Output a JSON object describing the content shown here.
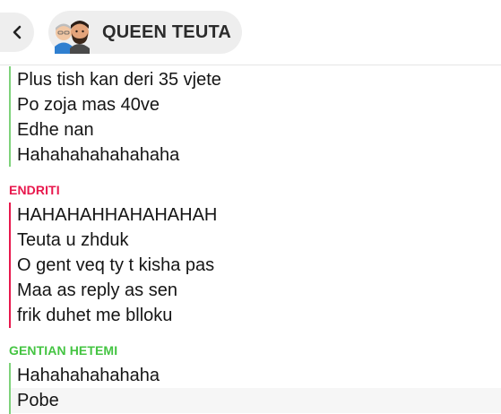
{
  "header": {
    "title": "QUEEN TEUTA",
    "back_icon": "chevron-left-icon",
    "avatar_icon": "group-bitmoji-avatar-icon"
  },
  "colors": {
    "green_sender": "#44c442",
    "red_sender": "#e8184d",
    "bar_green": "#7ed27b",
    "bar_red": "#e8184d"
  },
  "messages": {
    "group1": {
      "lines": [
        "Plus tish kan deri 35 vjete",
        "Po zoja mas 40ve",
        "Edhe nan",
        "Hahahahahahahaha"
      ]
    },
    "group2": {
      "sender": "ENDRITI",
      "lines": [
        "HAHAHAHHAHAHAHAH",
        "Teuta u zhduk",
        "O gent veq ty t kisha pas",
        "Maa as reply as sen",
        "frik duhet me blloku"
      ]
    },
    "group3": {
      "sender": "GENTIAN HETEMI",
      "lines": [
        "Hahahahahahaha",
        "Pobe"
      ]
    }
  }
}
